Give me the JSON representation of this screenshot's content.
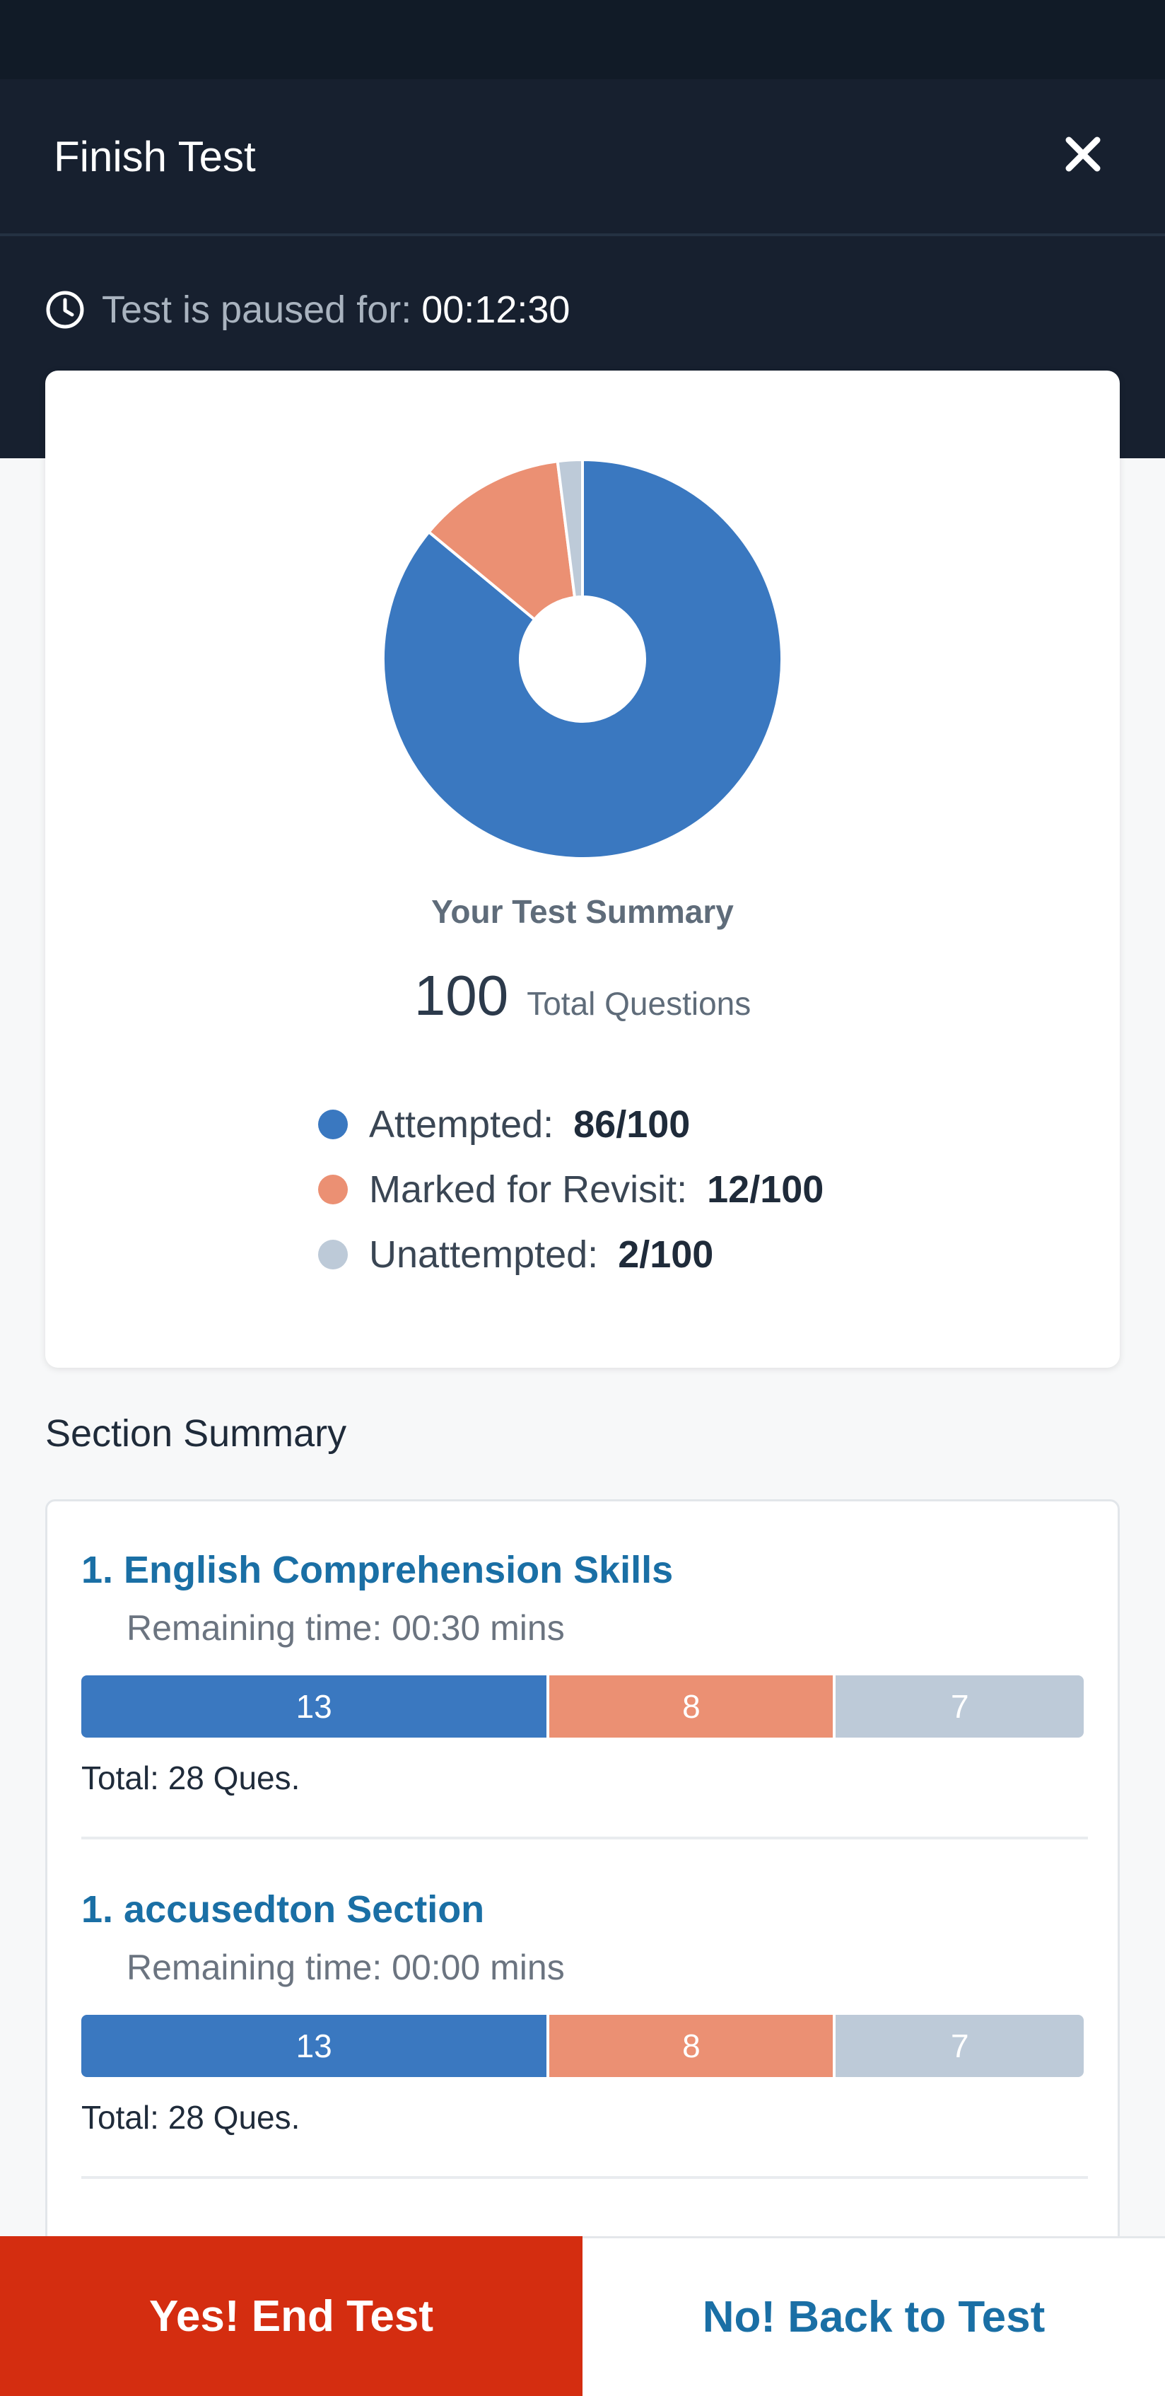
{
  "header": {
    "title": "Finish Test",
    "close_icon": "close-icon"
  },
  "paused": {
    "icon": "clock-icon",
    "label": "Test is paused for:",
    "time": "00:12:30"
  },
  "summary": {
    "title": "Your Test Summary",
    "total_number": "100",
    "total_label": "Total Questions",
    "legend": [
      {
        "label": "Attempted:",
        "value": "86/100",
        "color": "#3a78c0"
      },
      {
        "label": "Marked for Revisit:",
        "value": "12/100",
        "color": "#eb9073"
      },
      {
        "label": "Unattempted:",
        "value": "2/100",
        "color": "#bdcad8"
      }
    ]
  },
  "chart_data": {
    "type": "pie",
    "donut": true,
    "slices": [
      {
        "label": "Attempted",
        "value": 86,
        "color": "#3a78c0"
      },
      {
        "label": "Marked for Revisit",
        "value": 12,
        "color": "#eb9073"
      },
      {
        "label": "Unattempted",
        "value": 2,
        "color": "#bdcad8"
      }
    ]
  },
  "sections_heading": "Section Summary",
  "sections": [
    {
      "name": "1. English Comprehension Skills",
      "remaining": "Remaining time: 00:30 mins",
      "attempted": 13,
      "revisit": 8,
      "unattempted": 7,
      "attempted_label": "13",
      "revisit_label": "8",
      "unattempted_label": "7",
      "total": "Total: 28 Ques."
    },
    {
      "name": "1. accusedton Section",
      "remaining": "Remaining time: 00:00 mins",
      "attempted": 13,
      "revisit": 8,
      "unattempted": 7,
      "attempted_label": "13",
      "revisit_label": "8",
      "unattempted_label": "7",
      "total": "Total: 28 Ques."
    }
  ],
  "colors": {
    "attempted": "#3a78c0",
    "revisit": "#eb9073",
    "unattempted": "#bdcad8",
    "end_button": "#d42d10",
    "link": "#1a6fa5"
  },
  "footer": {
    "end_label": "Yes! End Test",
    "back_label": "No! Back to Test"
  }
}
